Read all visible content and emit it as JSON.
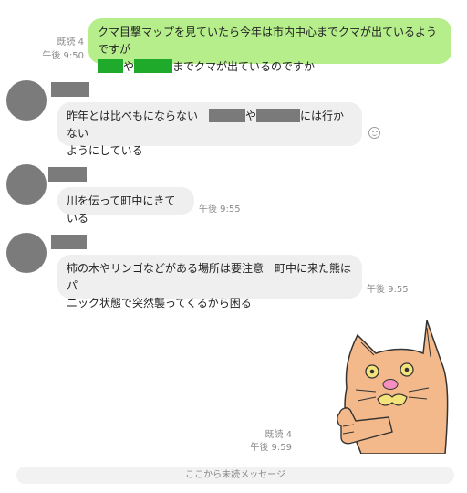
{
  "messages": [
    {
      "side": "me",
      "read": "既読 4",
      "time": "午後 9:50",
      "line1": "クマ目撃マップを見ていたら今年は市内中心までクマが出ているようですが",
      "line2_sep": "や",
      "line2_tail": "までクマが出ているのですか"
    },
    {
      "side": "them",
      "line1_head": "昨年とは比べもにならない",
      "line1_sep": "や",
      "line1_tail": "には行かない",
      "line2": "ようにしている"
    },
    {
      "side": "them",
      "text": "川を伝って町中にきている",
      "time": "午後 9:55"
    },
    {
      "side": "them",
      "line1": "柿の木やリンゴなどがある場所は要注意　町中に来た熊はパ",
      "line2": "ニック状態で突然襲ってくるから困る",
      "time": "午後 9:55"
    },
    {
      "side": "me",
      "type": "sticker",
      "sticker": "orange-cat-thumbs-up",
      "read": "既読 4",
      "time": "午後 9:59"
    }
  ],
  "unread_divider": "ここから未読メッセージ",
  "colors": {
    "my_bubble": "#b6ee8c",
    "their_bubble": "#efefef",
    "redaction_green": "#1faa2b",
    "redaction_gray": "#7a7a7a"
  }
}
